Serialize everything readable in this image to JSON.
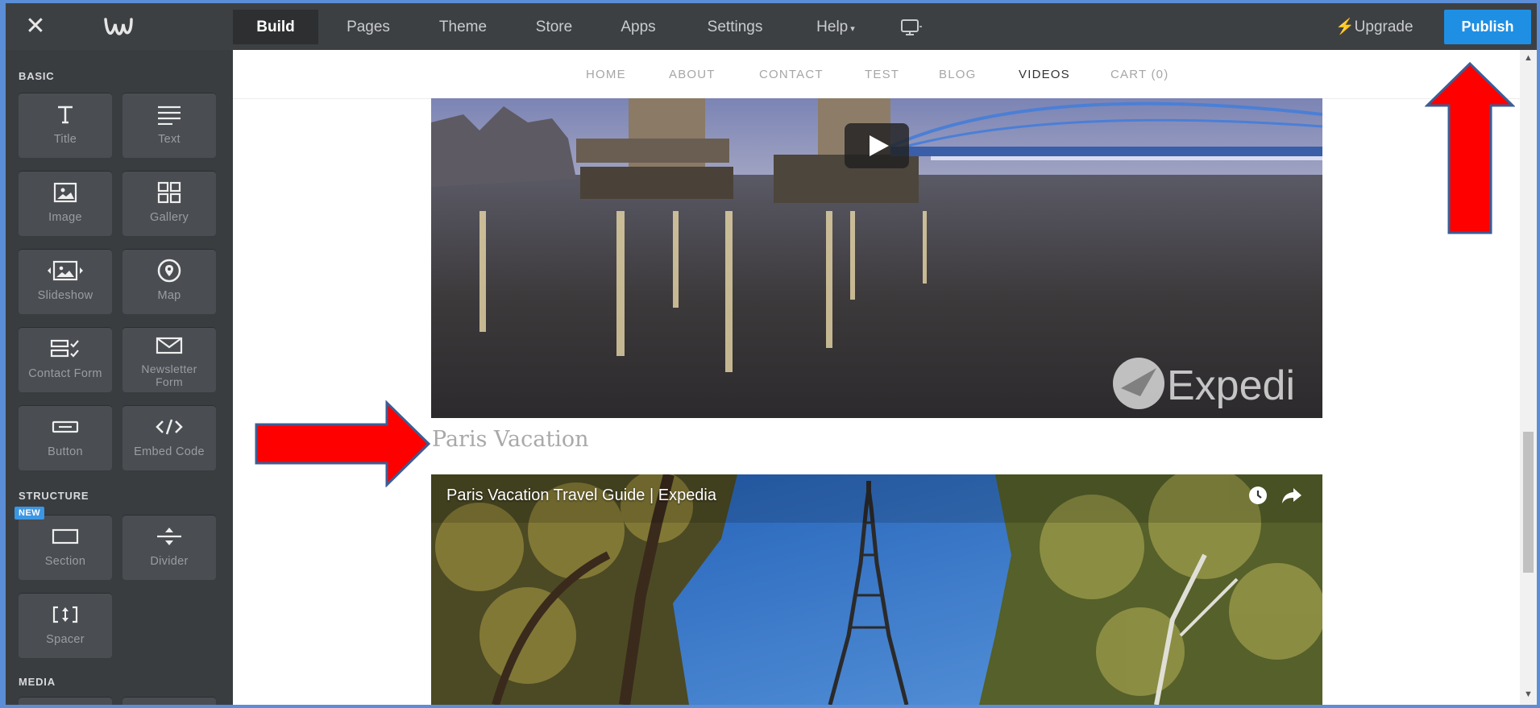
{
  "toolbar": {
    "tabs": [
      {
        "label": "Build",
        "active": true
      },
      {
        "label": "Pages"
      },
      {
        "label": "Theme"
      },
      {
        "label": "Store"
      },
      {
        "label": "Apps"
      },
      {
        "label": "Settings"
      },
      {
        "label": "Help"
      }
    ],
    "upgrade_label": "Upgrade",
    "publish_label": "Publish",
    "device_icon": "monitor-icon"
  },
  "sidebar": {
    "basic_heading": "BASIC",
    "structure_heading": "STRUCTURE",
    "media_heading": "MEDIA",
    "new_badge": "NEW",
    "basic_items": [
      {
        "label": "Title",
        "icon": "title-icon"
      },
      {
        "label": "Text",
        "icon": "text-icon"
      },
      {
        "label": "Image",
        "icon": "image-icon"
      },
      {
        "label": "Gallery",
        "icon": "gallery-icon"
      },
      {
        "label": "Slideshow",
        "icon": "slideshow-icon"
      },
      {
        "label": "Map",
        "icon": "map-icon"
      },
      {
        "label": "Contact Form",
        "icon": "contact-form-icon"
      },
      {
        "label": "Newsletter Form",
        "icon": "newsletter-icon"
      },
      {
        "label": "Button",
        "icon": "button-icon"
      },
      {
        "label": "Embed Code",
        "icon": "embed-code-icon"
      }
    ],
    "structure_items": [
      {
        "label": "Section",
        "icon": "section-icon"
      },
      {
        "label": "Divider",
        "icon": "divider-icon"
      },
      {
        "label": "Spacer",
        "icon": "spacer-icon"
      }
    ]
  },
  "site_nav": {
    "links": [
      "HOME",
      "ABOUT",
      "CONTACT",
      "TEST",
      "BLOG",
      "VIDEOS",
      "CART (0)"
    ],
    "current": "VIDEOS"
  },
  "content": {
    "video1_watermark": "Expedi",
    "section_title": "Paris Vacation",
    "video2_title": "Paris Vacation Travel Guide | Expedia"
  },
  "colors": {
    "toolbar_bg": "#3d4043",
    "sidebar_bg": "#3a3d40",
    "publish_bg": "#1f8fe3",
    "annotation_arrow": "#ff0000"
  }
}
